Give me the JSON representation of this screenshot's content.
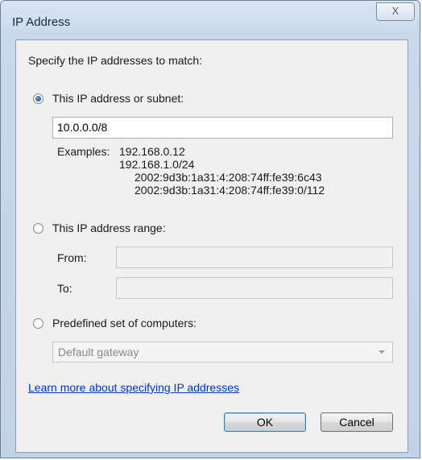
{
  "window": {
    "title": "IP Address",
    "close_glyph": "X"
  },
  "dialog": {
    "instruction": "Specify the IP addresses to match:",
    "option_subnet": {
      "label": "This IP address or subnet:",
      "selected": true,
      "value": "10.0.0.0/8"
    },
    "examples": {
      "label": "Examples:",
      "items": [
        "192.168.0.12",
        "192.168.1.0/24",
        "2002:9d3b:1a31:4:208:74ff:fe39:6c43",
        "2002:9d3b:1a31:4:208:74ff:fe39:0/112"
      ]
    },
    "option_range": {
      "label": "This IP address range:",
      "selected": false,
      "from_label": "From:",
      "to_label": "To:",
      "from_value": "",
      "to_value": ""
    },
    "option_predefined": {
      "label": "Predefined set of computers:",
      "selected": false,
      "dropdown_value": "Default gateway"
    },
    "learn_more_link": "Learn more about specifying IP addresses",
    "ok_label": "OK",
    "cancel_label": "Cancel"
  },
  "icons": {
    "close": "close-icon",
    "dropdown": "chevron-down-icon"
  },
  "colors": {
    "link": "#0033cc",
    "title_bar": "#c9d9ec",
    "dialog_bg": "#f0f0f0"
  }
}
